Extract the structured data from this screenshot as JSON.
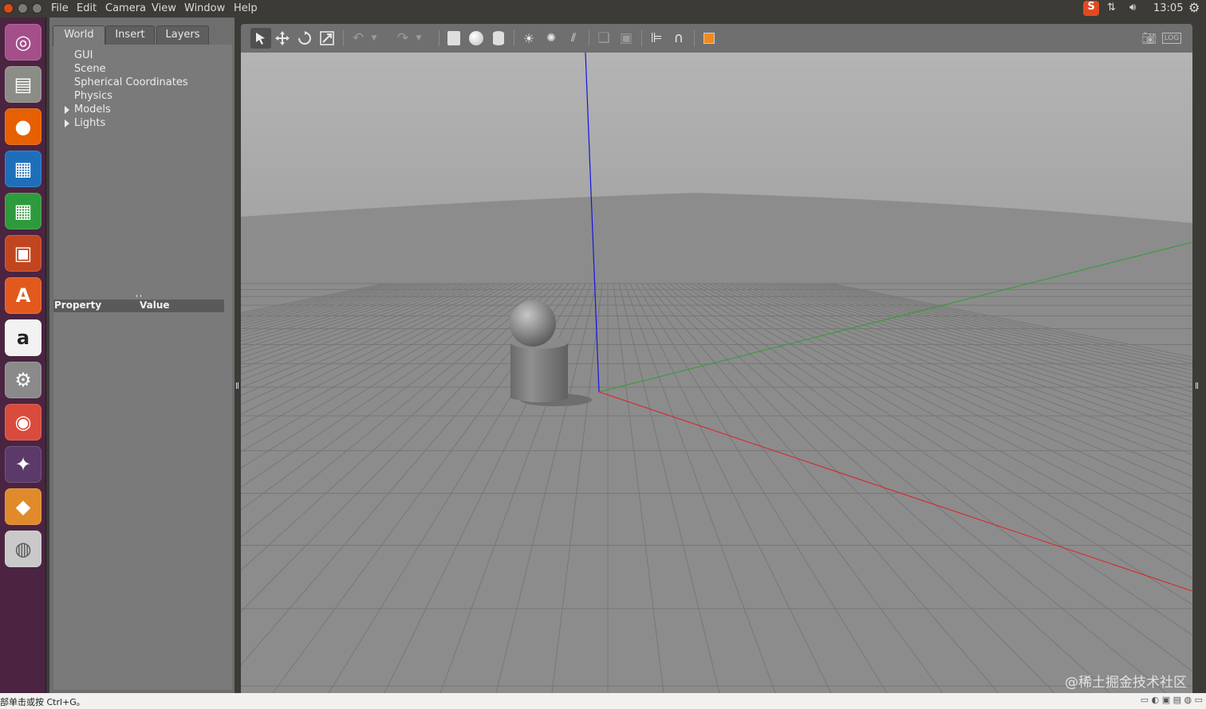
{
  "top_panel": {
    "menu": [
      "File",
      "Edit",
      "Camera",
      "View",
      "Window",
      "Help"
    ],
    "clock": "13:05",
    "colors": {
      "close": "#df4a16",
      "minimize": "#7d7b74",
      "maximize": "#7d7b74"
    }
  },
  "launcher": {
    "icons": [
      {
        "name": "ubuntu-dash-icon",
        "color": "#a44f8a",
        "glyph": "◎"
      },
      {
        "name": "files-icon",
        "color": "#8d8d87",
        "glyph": "▤"
      },
      {
        "name": "firefox-icon",
        "color": "#e66000",
        "glyph": "●"
      },
      {
        "name": "writer-icon",
        "color": "#1e6fb9",
        "glyph": "▦"
      },
      {
        "name": "calc-icon",
        "color": "#2f9a3d",
        "glyph": "▦"
      },
      {
        "name": "impress-icon",
        "color": "#c1461f",
        "glyph": "▣"
      },
      {
        "name": "software-center-icon",
        "color": "#e2591e",
        "glyph": "A"
      },
      {
        "name": "amazon-icon",
        "color": "#f2f2f2",
        "glyph": "a"
      },
      {
        "name": "settings-icon",
        "color": "#8a8a8a",
        "glyph": "⚙"
      },
      {
        "name": "chrome-icon",
        "color": "#d94b3c",
        "glyph": "◉"
      },
      {
        "name": "ros-icon",
        "color": "#5b3a6a",
        "glyph": "✦"
      },
      {
        "name": "gazebo-icon",
        "color": "#e08a2c",
        "glyph": "◆"
      },
      {
        "name": "dvd-icon",
        "color": "#c9c9c9",
        "glyph": "◍"
      }
    ]
  },
  "left_panel": {
    "tabs": [
      "World",
      "Insert",
      "Layers"
    ],
    "tree": [
      "GUI",
      "Scene",
      "Spherical Coordinates",
      "Physics",
      "Models",
      "Lights"
    ],
    "prop_header": {
      "property": "Property",
      "value": "Value"
    }
  },
  "status_bar": {
    "text": "部单击或按 Ctrl+G。"
  },
  "watermark": "@稀土掘金技术社区"
}
